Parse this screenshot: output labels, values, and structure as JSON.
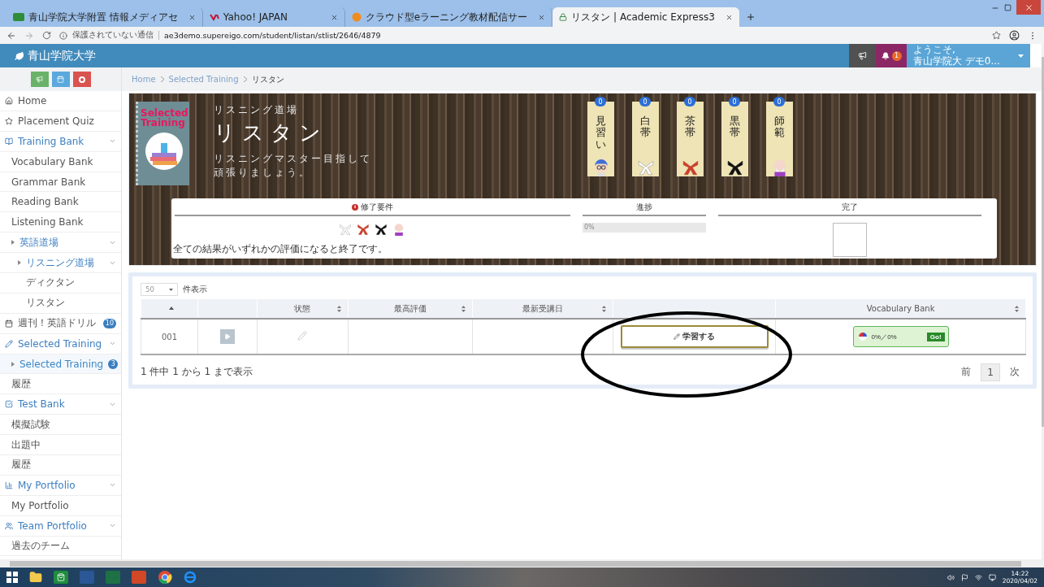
{
  "browser": {
    "tabs": [
      {
        "title": "青山学院大学附置 情報メディアセ",
        "selected": false,
        "kind": "aim"
      },
      {
        "title": "Yahoo! JAPAN",
        "selected": false,
        "kind": "yahoo"
      },
      {
        "title": "クラウド型eラーニング教材配信サー",
        "selected": false,
        "kind": "cloud"
      },
      {
        "title": "リスタン | Academic Express3",
        "selected": true,
        "kind": "lock"
      }
    ],
    "insecure_label": "保護されていない通信",
    "url": "ae3demo.supereigo.com/student/listan/stlist/2646/4879"
  },
  "header": {
    "logo": "青山学院大学",
    "notification_count": "1",
    "welcome": "ようこそ,",
    "user": "青山学院大 デモ0..."
  },
  "sidebar": {
    "items": [
      {
        "label": "Home",
        "kind": "home"
      },
      {
        "label": "Placement Quiz",
        "kind": "star"
      },
      {
        "label": "Training Bank",
        "kind": "book",
        "expanded": true,
        "children": [
          {
            "label": "Vocabulary Bank"
          },
          {
            "label": "Grammar Bank"
          },
          {
            "label": "Reading Bank"
          },
          {
            "label": "Listening Bank"
          },
          {
            "label": "英語道場",
            "expanded": true,
            "children": [
              {
                "label": "リスニング道場",
                "expanded": true,
                "children": [
                  {
                    "label": "ディクタン"
                  },
                  {
                    "label": "リスタン"
                  }
                ]
              }
            ]
          }
        ]
      },
      {
        "label": "週刊！英語ドリル",
        "kind": "calendar",
        "badge": "10"
      },
      {
        "label": "Selected Training",
        "kind": "pencil",
        "expanded": true,
        "children": [
          {
            "label": "Selected Training",
            "badge": "3",
            "selected": true
          },
          {
            "label": "履歴",
            "selected": false
          }
        ]
      },
      {
        "label": "Test Bank",
        "kind": "check",
        "expanded": true,
        "children": [
          {
            "label": "模擬試験"
          },
          {
            "label": "出題中"
          },
          {
            "label": "履歴"
          }
        ]
      },
      {
        "label": "My Portfolio",
        "kind": "chart",
        "expanded": true,
        "children": [
          {
            "label": "My Portfolio"
          }
        ]
      },
      {
        "label": "Team Portfolio",
        "kind": "users",
        "expanded": true,
        "children": [
          {
            "label": "過去のチーム"
          }
        ]
      }
    ]
  },
  "breadcrumb": [
    "Home",
    "Selected Training",
    "リスタン"
  ],
  "banner": {
    "cover_lines": [
      "Selected",
      "Training"
    ],
    "subtitle": "リスニング道場",
    "title": "リスタン",
    "description": [
      "リスニングマスター目指して",
      "頑張りましょう。"
    ],
    "ranks": [
      {
        "count": "0",
        "label": "見習い",
        "kind": "novice"
      },
      {
        "count": "0",
        "label": "白帯",
        "kind": "white"
      },
      {
        "count": "0",
        "label": "茶帯",
        "kind": "brown"
      },
      {
        "count": "0",
        "label": "黒帯",
        "kind": "black"
      },
      {
        "count": "0",
        "label": "師範",
        "kind": "master"
      }
    ],
    "requirements": {
      "heading": "修了要件",
      "emblems": [
        {
          "kind": "white"
        },
        {
          "kind": "brown"
        },
        {
          "kind": "black"
        },
        {
          "kind": "master"
        }
      ],
      "note": "全ての結果がいずれかの評価になると終了です。"
    },
    "progress": {
      "heading": "進捗",
      "level": 0,
      "text": "0%"
    },
    "completion": {
      "heading": "完了",
      "checked": false
    }
  },
  "table": {
    "page_size": "50",
    "page_size_suffix": "件表示",
    "columns": [
      {
        "sortable": true,
        "kind": "asc"
      },
      {
        "sortable": false
      },
      {
        "label": "状態",
        "sortable": true
      },
      {
        "label": "最高評価",
        "sortable": true
      },
      {
        "label": "最新受講日",
        "sortable": true
      },
      {
        "sortable": false
      },
      {
        "label": "Vocabulary Bank",
        "sortable": true
      }
    ],
    "rows": [
      {
        "number": "001",
        "action": "学習する",
        "vocab": "0%／0%",
        "go": "Go!"
      }
    ],
    "info": "1 件中 1 から 1 まで表示",
    "pager": [
      {
        "label": "前",
        "kind": "text"
      },
      {
        "label": "1",
        "kind": "page",
        "selected": true
      },
      {
        "label": "次",
        "kind": "text"
      }
    ]
  },
  "taskbar": {
    "time": "14:22",
    "date": "2020/04/02"
  }
}
